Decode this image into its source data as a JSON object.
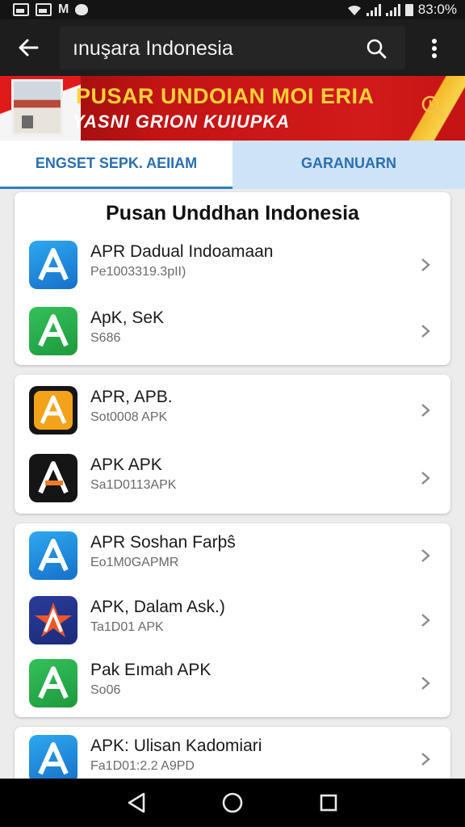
{
  "status_bar": {
    "battery_text": "83:0%"
  },
  "app_bar": {
    "search_text": "ınuşara Indonesia"
  },
  "banner": {
    "title": "PUSAR UNDOIAN MOI ERIA",
    "subtitle": "YASNI GRION KUIUPKA"
  },
  "tabs": [
    {
      "label": "ENGSET SEPK. AEIIAM"
    },
    {
      "label": "GARANUARN"
    }
  ],
  "cards": [
    {
      "title": "Pusan Unddhan Indonesia",
      "items": [
        {
          "title": "APR Dadual Indoamaan",
          "subtitle": "Pe1003319.3pII)",
          "icon": "blue-a-icon"
        },
        {
          "title": "ApK, SeK",
          "subtitle": "S686",
          "icon": "green-a-icon"
        }
      ]
    },
    {
      "items": [
        {
          "title": "APR, APB.",
          "subtitle": "Sot0008 APK",
          "icon": "orange-a-icon"
        },
        {
          "title": "APK APK",
          "subtitle": "Sa1D0113APK",
          "icon": "black-a-icon"
        }
      ]
    },
    {
      "items": [
        {
          "title": "APR Soshan Farþŝ",
          "subtitle": "Eo1M0GAPMR",
          "icon": "blue-a-icon"
        },
        {
          "title": "APK, Dalam Ask.)",
          "subtitle": "Ta1D01 APK",
          "icon": "star-a-icon"
        },
        {
          "title": "Pak Eımah APK",
          "subtitle": "So06",
          "icon": "green-a-icon"
        }
      ]
    },
    {
      "items": [
        {
          "title": "APK: Ulisan Kadomiari",
          "subtitle": "Fa1D01:2.2 A9PD",
          "icon": "blue-a-icon"
        }
      ]
    }
  ],
  "colors": {
    "accent": "#2f7dc6",
    "banner_red": "#c41414",
    "banner_yellow": "#ffd13a"
  }
}
